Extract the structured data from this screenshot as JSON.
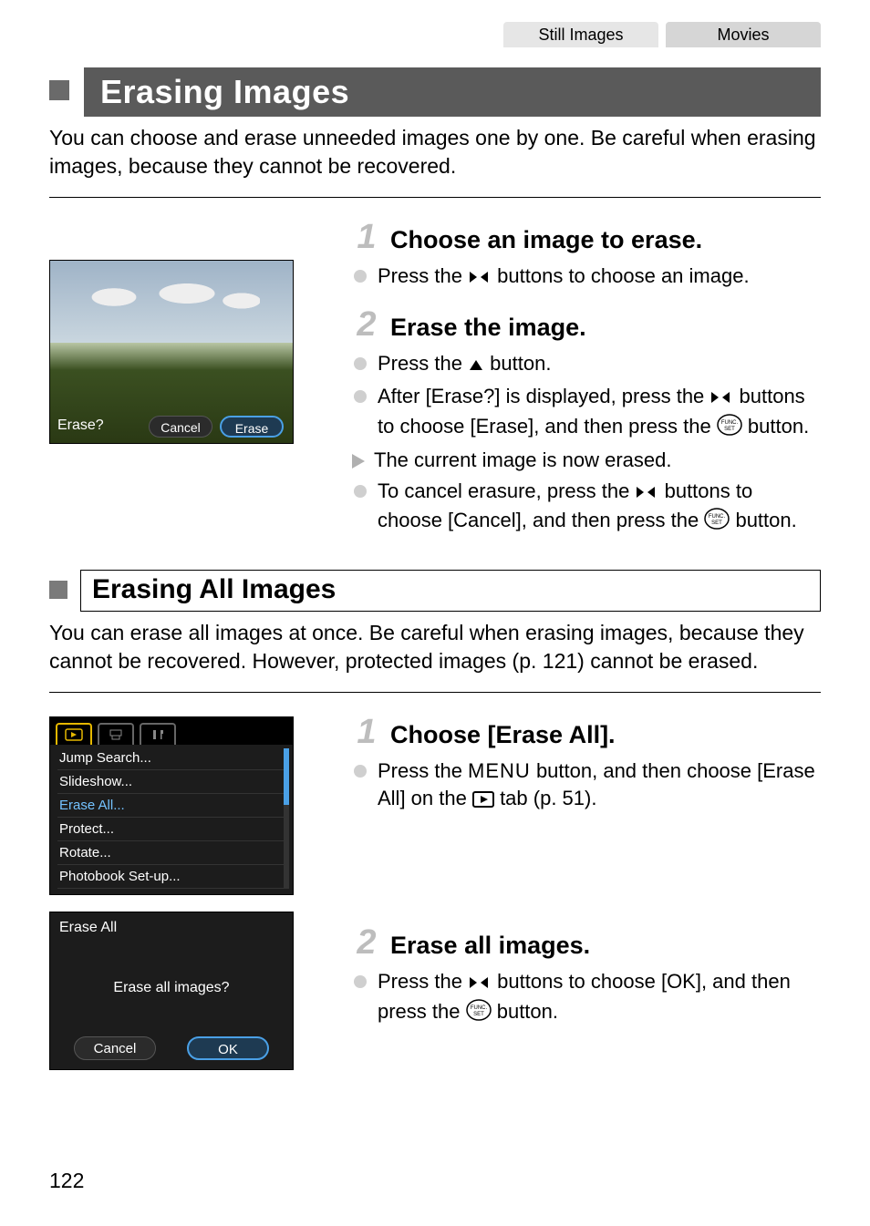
{
  "mode_tabs": {
    "still": "Still Images",
    "movies": "Movies"
  },
  "section1": {
    "title": "Erasing Images",
    "intro": "You can choose and erase unneeded images one by one. Be careful when erasing images, because they cannot be recovered.",
    "screenshot": {
      "prompt": "Erase?",
      "cancel": "Cancel",
      "erase": "Erase"
    },
    "step1": {
      "num": "1",
      "title": "Choose an image to erase.",
      "b1a": "Press the ",
      "b1b": " buttons to choose an image."
    },
    "step2": {
      "num": "2",
      "title": "Erase the image.",
      "b1a": "Press the ",
      "b1b": " button.",
      "b2a": "After [Erase?] is displayed, press the ",
      "b2b": " buttons to choose [Erase], and then press the ",
      "b2c": " button.",
      "b3": "The current image is now erased.",
      "b4a": "To cancel erasure, press the ",
      "b4b": " buttons to choose [Cancel], and then press the ",
      "b4c": " button."
    }
  },
  "section2": {
    "title": "Erasing All Images",
    "intro": "You can erase all images at once. Be careful when erasing images, because they cannot be recovered. However, protected images (p. 121) cannot be erased.",
    "menu": {
      "items": [
        "Jump Search...",
        "Slideshow...",
        "Erase All...",
        "Protect...",
        "Rotate...",
        "Photobook Set-up..."
      ],
      "selected_index": 2
    },
    "dialog": {
      "title": "Erase All",
      "message": "Erase all images?",
      "cancel": "Cancel",
      "ok": "OK"
    },
    "step1": {
      "num": "1",
      "title": "Choose [Erase All].",
      "b1a": "Press the ",
      "menu_word": "MENU",
      "b1b": " button, and then choose [Erase All] on the ",
      "b1c": " tab (p. 51)."
    },
    "step2": {
      "num": "2",
      "title": "Erase all images.",
      "b1a": "Press the ",
      "b1b": " buttons to choose [OK], and then press the ",
      "b1c": " button."
    }
  },
  "page_number": "122"
}
